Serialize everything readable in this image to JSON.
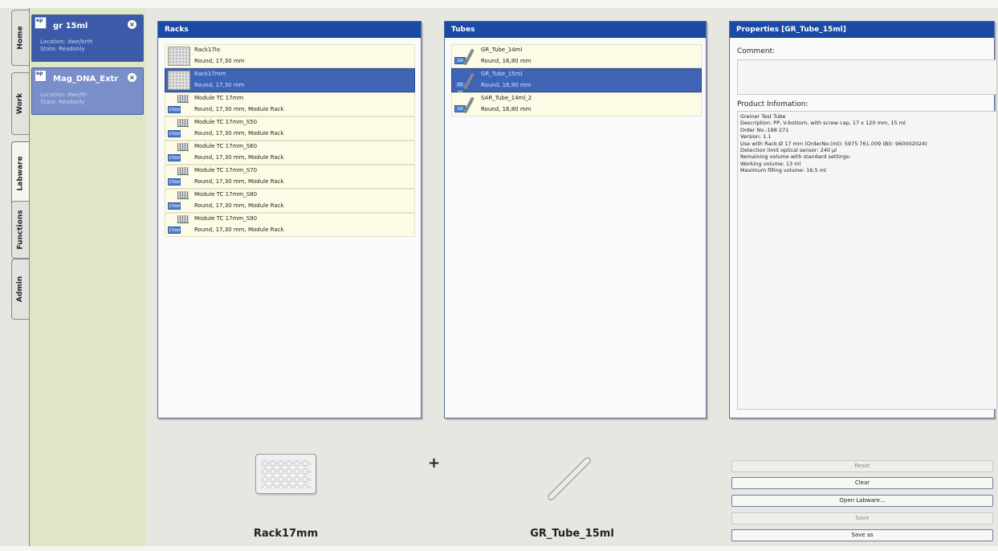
{
  "tabs": [
    "Home",
    "Work",
    "Labware",
    "Functions",
    "Admin"
  ],
  "sidebar": {
    "cards": [
      {
        "name": "gr 15ml",
        "location": "Location: dwe/brth",
        "state": "State:     Readonly"
      },
      {
        "name": "Mag_DNA_Extr",
        "location": "Location: dwe/th",
        "state": "State:     Readonly"
      }
    ]
  },
  "racks": {
    "title": "Racks",
    "items": [
      {
        "name": "Rack17lo",
        "desc": "Round, 17,30 mm",
        "icon": "plate-icon",
        "badge": ""
      },
      {
        "name": "Rack17mm",
        "desc": "Round, 17,30 mm",
        "icon": "plate-icon",
        "badge": ""
      },
      {
        "name": "Module TC 17mm",
        "desc": "Round, 17,30 mm, Module Rack",
        "icon": "module-rack-icon",
        "badge": "17mm"
      },
      {
        "name": "Module TC 17mm_S50",
        "desc": "Round, 17,30 mm, Module Rack",
        "icon": "module-rack-icon",
        "badge": "17mm"
      },
      {
        "name": "Module TC 17mm_S60",
        "desc": "Round, 17,30 mm, Module Rack",
        "icon": "module-rack-icon",
        "badge": "17mm"
      },
      {
        "name": "Module TC 17mm_S70",
        "desc": "Round, 17,30 mm, Module Rack",
        "icon": "module-rack-icon",
        "badge": "17mm"
      },
      {
        "name": "Module TC 17mm_S80",
        "desc": "Round, 17,30 mm, Module Rack",
        "icon": "module-rack-icon",
        "badge": "17mm"
      },
      {
        "name": "Module TC 17mm_S90",
        "desc": "Round, 17,30 mm, Module Rack",
        "icon": "module-rack-icon",
        "badge": "17mm"
      }
    ],
    "selected_index": 1
  },
  "tubes": {
    "title": "Tubes",
    "items": [
      {
        "name": "GR_Tube_14ml",
        "desc": "Round, 16,80 mm",
        "badge": "14 ml"
      },
      {
        "name": "GR_Tube_15ml",
        "desc": "Round, 16,90 mm",
        "badge": "15 ml"
      },
      {
        "name": "SAR_Tube_14ml_2",
        "desc": "Round, 16,80 mm",
        "badge": "14 ml"
      }
    ],
    "selected_index": 1
  },
  "properties": {
    "title": "Properties [GR_Tube_15ml]",
    "comment_label": "Comment:",
    "comment_value": "",
    "product_label": "Product Infomation:",
    "product_lines": [
      "Greiner Test Tube",
      "Description: PP, V-bottom, with screw cap, 17 x 120 mm, 15 ml",
      "Order No.:188 271",
      "Version: 1.1",
      "Use with Rack:Ø 17 mm (OrderNo.(int): 5975 761.009 (BI): 960002024)",
      "Detection limit optical sensor: 240 µl",
      "Remaining volume with standard settings:",
      "Working volume: 13 ml",
      "Maximum filling volume: 16,5 ml"
    ]
  },
  "selection": {
    "rack_name": "Rack17mm",
    "plus": "+",
    "tube_name": "GR_Tube_15ml"
  },
  "buttons": {
    "reset": "Reset",
    "clear": "Clear",
    "open": "Open Labware...",
    "save": "Save",
    "save_as": "Save as"
  },
  "colors": {
    "panel_header": "#1b4aa6",
    "selection": "#3f64b5",
    "row_background": "#fcfbe6",
    "sidebar": "#dfe6c6"
  }
}
